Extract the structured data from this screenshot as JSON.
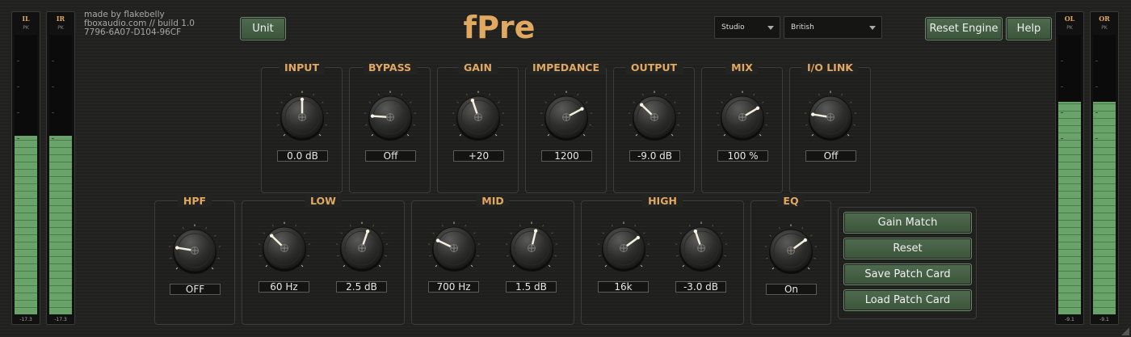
{
  "info": {
    "line1": "made by flakebelly",
    "line2": "fboxaudio.com // build 1.0",
    "line3": "7796-6A07-D104-96CF"
  },
  "header": {
    "logo": "fPre",
    "unit_label": "Unit",
    "reset_engine_label": "Reset Engine",
    "help_label": "Help",
    "preset_left": "Studio",
    "preset_right": "British"
  },
  "meters": {
    "il": {
      "label": "IL",
      "pk": "PK",
      "value": "-17.3",
      "level": 0.64
    },
    "ir": {
      "label": "IR",
      "pk": "PK",
      "value": "-17.3",
      "level": 0.64
    },
    "ol": {
      "label": "OL",
      "pk": "PK",
      "value": "-9.1",
      "level": 0.76
    },
    "or": {
      "label": "OR",
      "pk": "PK",
      "value": "-9.1",
      "level": 0.76
    }
  },
  "top_controls": [
    {
      "title": "INPUT",
      "value": "0.0 dB",
      "position": 0.5
    },
    {
      "title": "BYPASS",
      "value": "Off",
      "position": 0.18
    },
    {
      "title": "GAIN",
      "value": "+20",
      "position": 0.43
    },
    {
      "title": "IMPEDANCE",
      "value": "1200",
      "position": 0.73
    },
    {
      "title": "OUTPUT",
      "value": "-9.0 dB",
      "position": 0.33
    },
    {
      "title": "MIX",
      "value": "100 %",
      "position": 0.72
    },
    {
      "title": "I/O LINK",
      "value": "Off",
      "position": 0.2
    }
  ],
  "bottom_panels": {
    "hpf": {
      "title": "HPF",
      "value": "OFF",
      "position": 0.2
    },
    "low": {
      "title": "LOW",
      "freq": "60 Hz",
      "freq_pos": 0.33,
      "gain": "2.5 dB",
      "gain_pos": 0.57
    },
    "mid": {
      "title": "MID",
      "freq": "700 Hz",
      "freq_pos": 0.26,
      "gain": "1.5 dB",
      "gain_pos": 0.55
    },
    "high": {
      "title": "HIGH",
      "freq": "16k",
      "freq_pos": 0.7,
      "gain": "-3.0 dB",
      "gain_pos": 0.43
    },
    "eq": {
      "title": "EQ",
      "value": "On",
      "position": 0.7
    }
  },
  "actions": {
    "gain_match": "Gain Match",
    "reset": "Reset",
    "save_patch": "Save Patch Card",
    "load_patch": "Load Patch Card"
  },
  "colors": {
    "accent": "#e0a860",
    "button_green": "#4f6b4f",
    "meter_green": "#6aa36a"
  }
}
